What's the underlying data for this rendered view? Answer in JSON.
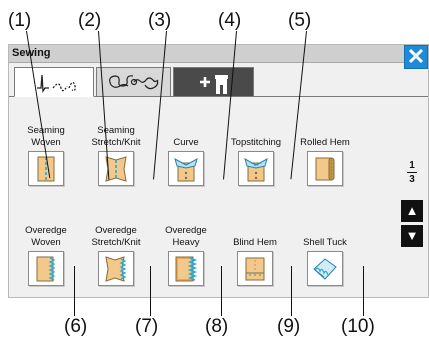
{
  "window": {
    "title": "Sewing",
    "close_icon": "close-x-icon"
  },
  "tabs": [
    {
      "name": "utility-stitches",
      "icon": "utility-stitch-icon",
      "selected": true
    },
    {
      "name": "decorative-stitches",
      "icon": "decorative-stitch-icon",
      "selected": false
    },
    {
      "name": "custom-stitches",
      "icon": "plus-presser-foot-icon",
      "selected": false
    }
  ],
  "items": [
    {
      "label": "Seaming Woven",
      "callout": "(1)",
      "icon": "seam-woven-icon"
    },
    {
      "label": "Seaming Stretch/Knit",
      "callout": "(2)",
      "icon": "seam-knit-icon"
    },
    {
      "label": "Curve",
      "callout": "(3)",
      "icon": "curve-collar-icon"
    },
    {
      "label": "Topstitching",
      "callout": "(4)",
      "icon": "topstitch-collar-icon"
    },
    {
      "label": "Rolled Hem",
      "callout": "(5)",
      "icon": "rolled-hem-icon"
    },
    {
      "label": "Overedge Woven",
      "callout": "(6)",
      "icon": "overedge-woven-icon"
    },
    {
      "label": "Overedge Stretch/Knit",
      "callout": "(7)",
      "icon": "overedge-knit-icon"
    },
    {
      "label": "Overedge Heavy",
      "callout": "(8)",
      "icon": "overedge-heavy-icon"
    },
    {
      "label": "Blind Hem",
      "callout": "(9)",
      "icon": "blind-hem-icon"
    },
    {
      "label": "Shell Tuck",
      "callout": "(10)",
      "icon": "shell-tuck-icon"
    }
  ],
  "pager": {
    "current": "1",
    "total": "3",
    "up_icon": "triangle-up-icon",
    "down_icon": "triangle-down-icon",
    "up_glyph": "▲",
    "down_glyph": "▼"
  },
  "colors": {
    "accent": "#1e8bd8",
    "fabric": "#f2c98a",
    "stitch": "#2aa8d8"
  }
}
